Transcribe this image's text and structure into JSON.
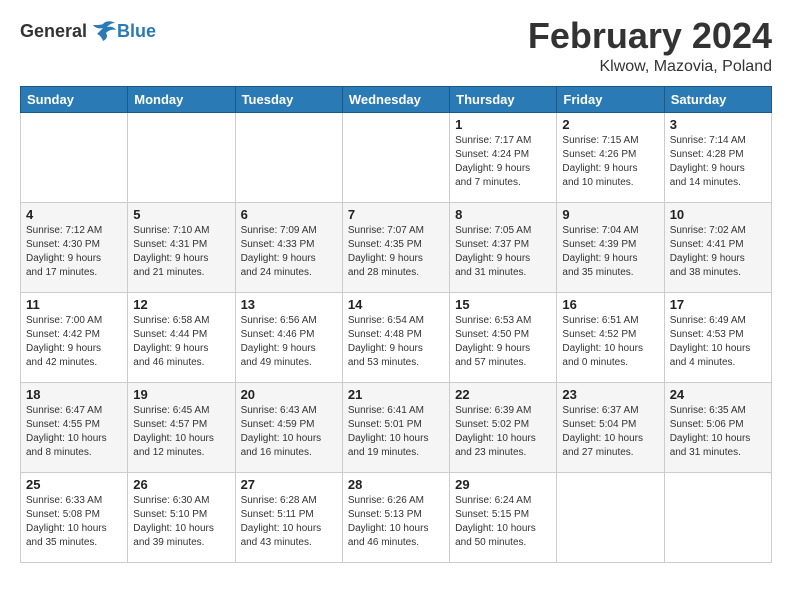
{
  "logo": {
    "general": "General",
    "blue": "Blue"
  },
  "title": {
    "month": "February 2024",
    "location": "Klwow, Mazovia, Poland"
  },
  "days_of_week": [
    "Sunday",
    "Monday",
    "Tuesday",
    "Wednesday",
    "Thursday",
    "Friday",
    "Saturday"
  ],
  "weeks": [
    [
      {
        "day": "",
        "info": ""
      },
      {
        "day": "",
        "info": ""
      },
      {
        "day": "",
        "info": ""
      },
      {
        "day": "",
        "info": ""
      },
      {
        "day": "1",
        "info": "Sunrise: 7:17 AM\nSunset: 4:24 PM\nDaylight: 9 hours\nand 7 minutes."
      },
      {
        "day": "2",
        "info": "Sunrise: 7:15 AM\nSunset: 4:26 PM\nDaylight: 9 hours\nand 10 minutes."
      },
      {
        "day": "3",
        "info": "Sunrise: 7:14 AM\nSunset: 4:28 PM\nDaylight: 9 hours\nand 14 minutes."
      }
    ],
    [
      {
        "day": "4",
        "info": "Sunrise: 7:12 AM\nSunset: 4:30 PM\nDaylight: 9 hours\nand 17 minutes."
      },
      {
        "day": "5",
        "info": "Sunrise: 7:10 AM\nSunset: 4:31 PM\nDaylight: 9 hours\nand 21 minutes."
      },
      {
        "day": "6",
        "info": "Sunrise: 7:09 AM\nSunset: 4:33 PM\nDaylight: 9 hours\nand 24 minutes."
      },
      {
        "day": "7",
        "info": "Sunrise: 7:07 AM\nSunset: 4:35 PM\nDaylight: 9 hours\nand 28 minutes."
      },
      {
        "day": "8",
        "info": "Sunrise: 7:05 AM\nSunset: 4:37 PM\nDaylight: 9 hours\nand 31 minutes."
      },
      {
        "day": "9",
        "info": "Sunrise: 7:04 AM\nSunset: 4:39 PM\nDaylight: 9 hours\nand 35 minutes."
      },
      {
        "day": "10",
        "info": "Sunrise: 7:02 AM\nSunset: 4:41 PM\nDaylight: 9 hours\nand 38 minutes."
      }
    ],
    [
      {
        "day": "11",
        "info": "Sunrise: 7:00 AM\nSunset: 4:42 PM\nDaylight: 9 hours\nand 42 minutes."
      },
      {
        "day": "12",
        "info": "Sunrise: 6:58 AM\nSunset: 4:44 PM\nDaylight: 9 hours\nand 46 minutes."
      },
      {
        "day": "13",
        "info": "Sunrise: 6:56 AM\nSunset: 4:46 PM\nDaylight: 9 hours\nand 49 minutes."
      },
      {
        "day": "14",
        "info": "Sunrise: 6:54 AM\nSunset: 4:48 PM\nDaylight: 9 hours\nand 53 minutes."
      },
      {
        "day": "15",
        "info": "Sunrise: 6:53 AM\nSunset: 4:50 PM\nDaylight: 9 hours\nand 57 minutes."
      },
      {
        "day": "16",
        "info": "Sunrise: 6:51 AM\nSunset: 4:52 PM\nDaylight: 10 hours\nand 0 minutes."
      },
      {
        "day": "17",
        "info": "Sunrise: 6:49 AM\nSunset: 4:53 PM\nDaylight: 10 hours\nand 4 minutes."
      }
    ],
    [
      {
        "day": "18",
        "info": "Sunrise: 6:47 AM\nSunset: 4:55 PM\nDaylight: 10 hours\nand 8 minutes."
      },
      {
        "day": "19",
        "info": "Sunrise: 6:45 AM\nSunset: 4:57 PM\nDaylight: 10 hours\nand 12 minutes."
      },
      {
        "day": "20",
        "info": "Sunrise: 6:43 AM\nSunset: 4:59 PM\nDaylight: 10 hours\nand 16 minutes."
      },
      {
        "day": "21",
        "info": "Sunrise: 6:41 AM\nSunset: 5:01 PM\nDaylight: 10 hours\nand 19 minutes."
      },
      {
        "day": "22",
        "info": "Sunrise: 6:39 AM\nSunset: 5:02 PM\nDaylight: 10 hours\nand 23 minutes."
      },
      {
        "day": "23",
        "info": "Sunrise: 6:37 AM\nSunset: 5:04 PM\nDaylight: 10 hours\nand 27 minutes."
      },
      {
        "day": "24",
        "info": "Sunrise: 6:35 AM\nSunset: 5:06 PM\nDaylight: 10 hours\nand 31 minutes."
      }
    ],
    [
      {
        "day": "25",
        "info": "Sunrise: 6:33 AM\nSunset: 5:08 PM\nDaylight: 10 hours\nand 35 minutes."
      },
      {
        "day": "26",
        "info": "Sunrise: 6:30 AM\nSunset: 5:10 PM\nDaylight: 10 hours\nand 39 minutes."
      },
      {
        "day": "27",
        "info": "Sunrise: 6:28 AM\nSunset: 5:11 PM\nDaylight: 10 hours\nand 43 minutes."
      },
      {
        "day": "28",
        "info": "Sunrise: 6:26 AM\nSunset: 5:13 PM\nDaylight: 10 hours\nand 46 minutes."
      },
      {
        "day": "29",
        "info": "Sunrise: 6:24 AM\nSunset: 5:15 PM\nDaylight: 10 hours\nand 50 minutes."
      },
      {
        "day": "",
        "info": ""
      },
      {
        "day": "",
        "info": ""
      }
    ]
  ]
}
